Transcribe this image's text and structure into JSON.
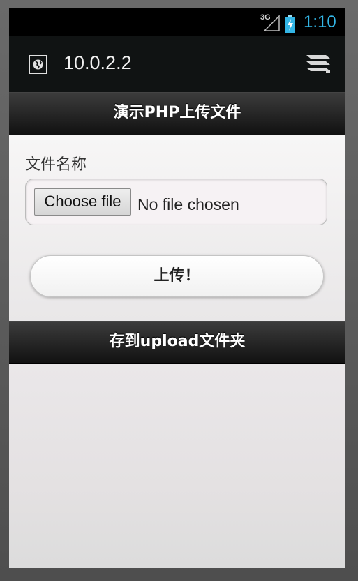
{
  "status_bar": {
    "network": "3G",
    "time": "1:10",
    "time_color": "#33b5e5"
  },
  "action_bar": {
    "url": "10.0.2.2",
    "icons": [
      "globe-icon",
      "tabs-icon"
    ]
  },
  "page": {
    "header_title": "演示PHP上传文件",
    "field_label": "文件名称",
    "file_input": {
      "button_label": "Choose file",
      "status": "No file chosen"
    },
    "upload_button_label": "上传！",
    "footer_text": "存到upload文件夹"
  }
}
